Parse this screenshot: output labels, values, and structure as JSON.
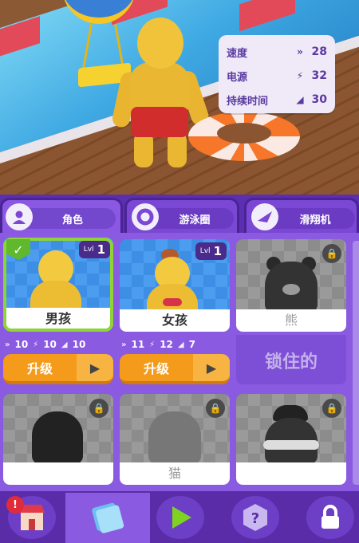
{
  "stats_panel": {
    "rows": [
      {
        "label": "速度",
        "icon": "double-chevron-icon",
        "value": "28"
      },
      {
        "label": "电源",
        "icon": "bolt-icon",
        "value": "32"
      },
      {
        "label": "持续时间",
        "icon": "wing-icon",
        "value": "30"
      }
    ]
  },
  "tabs": [
    {
      "label": "角色",
      "icon": "character-icon",
      "active": true
    },
    {
      "label": "游泳圈",
      "icon": "swim-ring-icon",
      "active": false
    },
    {
      "label": "滑翔机",
      "icon": "glider-icon",
      "active": false
    }
  ],
  "cards": [
    {
      "name": "男孩",
      "level_prefix": "Lvl",
      "level": "1",
      "selected": true,
      "locked": false
    },
    {
      "name": "女孩",
      "level_prefix": "Lvl",
      "level": "1",
      "selected": false,
      "locked": false
    },
    {
      "name": "熊",
      "locked": true
    },
    {
      "name": "",
      "locked": true
    },
    {
      "name": "猫",
      "locked": true
    },
    {
      "name": "",
      "locked": true
    }
  ],
  "card_stats": [
    {
      "speed": "10",
      "power": "10",
      "duration": "10"
    },
    {
      "speed": "11",
      "power": "12",
      "duration": "7"
    }
  ],
  "upgrade": {
    "label": "升级"
  },
  "locked_text": "锁住的",
  "nav": {
    "shop_badge": "!",
    "items": [
      "shop-icon",
      "skins-icon",
      "play-icon",
      "mystery-box-icon",
      "lock-icon"
    ]
  },
  "colors": {
    "accent_purple": "#7a48d4",
    "selected_green": "#8ed33a",
    "upgrade_orange": "#f59b1b",
    "play_green": "#7ed321"
  }
}
